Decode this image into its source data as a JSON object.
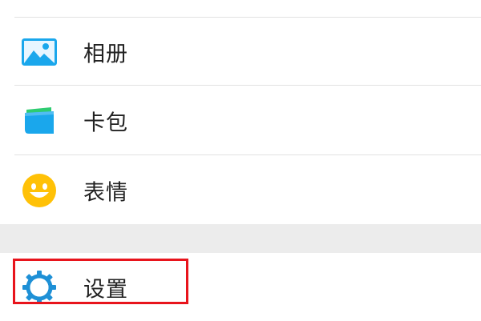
{
  "menu": {
    "items": [
      {
        "label": "相册",
        "icon": "photo-album-icon",
        "color": "#1aa7ec"
      },
      {
        "label": "卡包",
        "icon": "card-wallet-icon",
        "color": "#1aa7ec"
      },
      {
        "label": "表情",
        "icon": "emoji-smile-icon",
        "color": "#ffc107"
      },
      {
        "label": "设置",
        "icon": "settings-gear-icon",
        "color": "#1e90d6"
      }
    ]
  },
  "highlight": {
    "color": "#e8141c"
  }
}
